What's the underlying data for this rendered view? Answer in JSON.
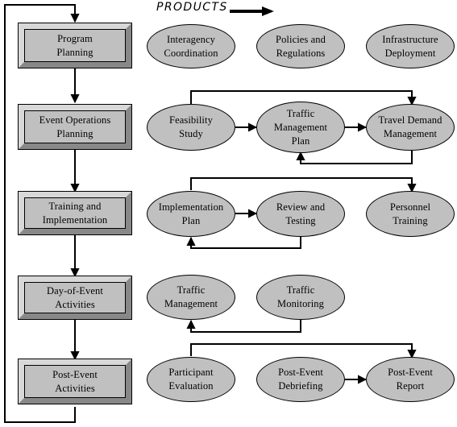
{
  "header": {
    "title": "PRODUCTS",
    "arrow_icon": "right-arrow-icon"
  },
  "phases": [
    {
      "id": "program-planning",
      "label": "Program\nPlanning"
    },
    {
      "id": "event-operations-planning",
      "label": "Event Operations\nPlanning"
    },
    {
      "id": "training-and-implementation",
      "label": "Training and\nImplementation"
    },
    {
      "id": "day-of-event-activities",
      "label": "Day-of-Event\nActivities"
    },
    {
      "id": "post-event-activities",
      "label": "Post-Event\nActivities"
    }
  ],
  "products": [
    {
      "id": "interagency-coordination",
      "label": "Interagency\nCoordination",
      "row": 1
    },
    {
      "id": "policies-and-regulations",
      "label": "Policies and\nRegulations",
      "row": 1
    },
    {
      "id": "infrastructure-deployment",
      "label": "Infrastructure\nDeployment",
      "row": 1
    },
    {
      "id": "feasibility-study",
      "label": "Feasibility\nStudy",
      "row": 2
    },
    {
      "id": "traffic-management-plan",
      "label": "Traffic\nManagement\nPlan",
      "row": 2
    },
    {
      "id": "travel-demand-management",
      "label": "Travel Demand\nManagement",
      "row": 2
    },
    {
      "id": "implementation-plan",
      "label": "Implementation\nPlan",
      "row": 3
    },
    {
      "id": "review-and-testing",
      "label": "Review and\nTesting",
      "row": 3
    },
    {
      "id": "personnel-training",
      "label": "Personnel\nTraining",
      "row": 3
    },
    {
      "id": "traffic-management",
      "label": "Traffic\nManagement",
      "row": 4
    },
    {
      "id": "traffic-monitoring",
      "label": "Traffic\nMonitoring",
      "row": 4
    },
    {
      "id": "participant-evaluation",
      "label": "Participant\nEvaluation",
      "row": 5
    },
    {
      "id": "post-event-debriefing",
      "label": "Post-Event\nDebriefing",
      "row": 5
    },
    {
      "id": "post-event-report",
      "label": "Post-Event\nReport",
      "row": 5
    }
  ],
  "colors": {
    "fill": "#c0c0c0",
    "bevel_light": "#d8d8d8",
    "bevel_dark": "#888888",
    "stroke": "#000000",
    "background": "#ffffff"
  }
}
